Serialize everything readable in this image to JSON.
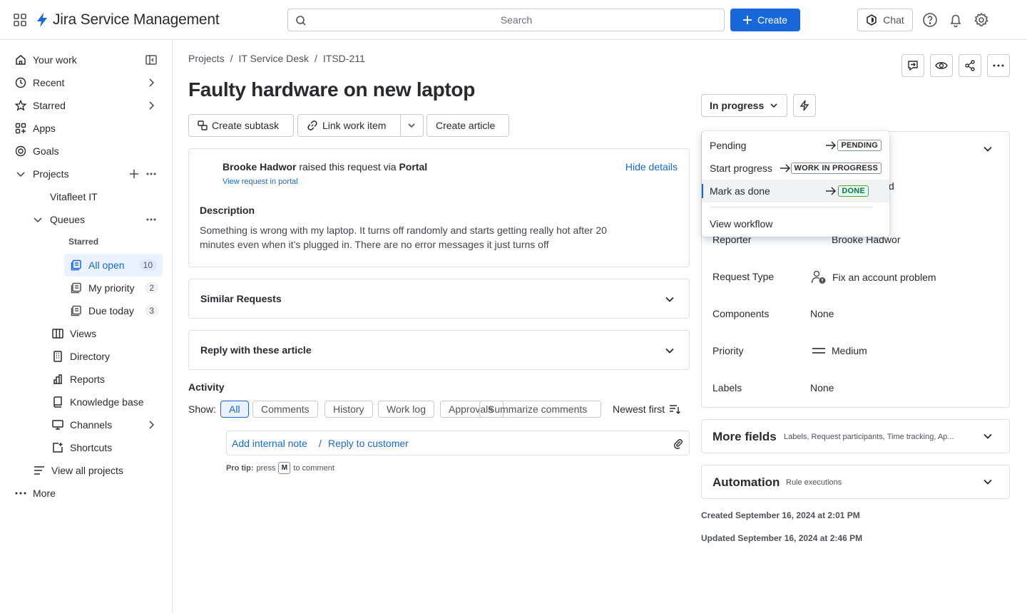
{
  "top": {
    "app_name": "Jira Service Management",
    "search_placeholder": "Search",
    "create_label": "Create",
    "chat_label": "Chat",
    "accent": "#1868db"
  },
  "sidebar": {
    "your_work": "Your work",
    "recent": "Recent",
    "starred": "Starred",
    "apps": "Apps",
    "goals": "Goals",
    "projects": "Projects",
    "project_name": "Vitafleet IT",
    "queues": "Queues",
    "starred_header": "Starred",
    "all_open": "All open",
    "all_open_count": "10",
    "my_priority": "My priority",
    "my_priority_count": "2",
    "due_today": "Due today",
    "due_today_count": "3",
    "views": "Views",
    "directory": "Directory",
    "reports": "Reports",
    "knowledge_base": "Knowledge base",
    "channels": "Channels",
    "shortcuts": "Shortcuts",
    "view_all_projects": "View all projects",
    "more": "More"
  },
  "breadcrumb": {
    "projects": "Projects",
    "sep": "/",
    "service_desk": "IT Service Desk",
    "issue_key": "ITSD-211"
  },
  "issue": {
    "title": "Faulty hardware on new laptop",
    "create_subtask": "Create subtask",
    "link_work_item": "Link work item",
    "create_article": "Create article"
  },
  "request": {
    "reporter": "Brooke Hadwor",
    "raised_text": "raised this request via",
    "channel": "Portal",
    "view_in_portal": "View request in portal",
    "hide_details": "Hide details",
    "description_label": "Description",
    "description_line1": "Something is wrong with my laptop. It turns off randomly and starts getting really hot after 20",
    "description_line2": "minutes even when it’s plugged in. There are no error messages it just turns off"
  },
  "sections": {
    "similar_requests": "Similar Requests",
    "reply_articles": "Reply with these article"
  },
  "activity": {
    "label": "Activity",
    "show_label": "Show:",
    "filters": [
      "All",
      "Comments",
      "History",
      "Work log",
      "Approvals"
    ],
    "summarize": "Summarize comments",
    "sort": "Newest first",
    "add_internal_note": "Add internal note",
    "separator": "/",
    "reply_to_customer": "Reply to customer",
    "pro_tip_label": "Pro tip:",
    "pro_tip_press": "press",
    "pro_tip_key": "M",
    "pro_tip_rest": "to comment"
  },
  "status": {
    "current": "In progress"
  },
  "transitions": {
    "items": [
      {
        "label": "Pending",
        "target": "PENDING"
      },
      {
        "label": "Start progress",
        "target": "WORK IN PROGRESS"
      },
      {
        "label": "Mark as done",
        "target": "DONE"
      }
    ],
    "view_workflow": "View workflow"
  },
  "details": {
    "peek_text": "d",
    "reporter_label": "Reporter",
    "reporter_value": "Brooke Hadwor",
    "request_type_label": "Request Type",
    "request_type_value": "Fix an account problem",
    "components_label": "Components",
    "components_value": "None",
    "priority_label": "Priority",
    "priority_value": "Medium",
    "labels_label": "Labels",
    "labels_value": "None"
  },
  "more_fields": {
    "title": "More fields",
    "subtitle": "Labels, Request participants, Time tracking, Ap..."
  },
  "automation": {
    "title": "Automation",
    "subtitle": "Rule executions"
  },
  "timestamps": {
    "created": "Created September 16, 2024 at 2:01 PM",
    "updated": "Updated September 16, 2024 at 2:46 PM"
  }
}
